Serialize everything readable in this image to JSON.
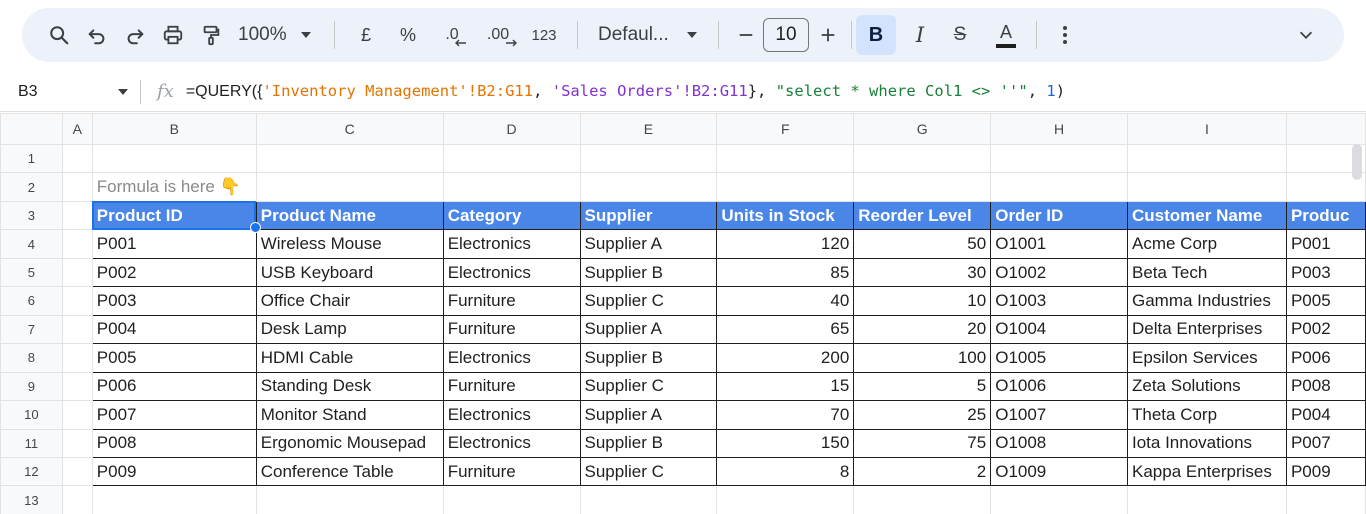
{
  "toolbar": {
    "zoom": "100%",
    "currency": "£",
    "percent": "%",
    "decrease_decimal": ".0",
    "increase_decimal": ".00",
    "number_format": "123",
    "font": "Defaul...",
    "font_size": "10",
    "bold": "B",
    "italic": "I",
    "strikethrough": "S",
    "text_color": "A"
  },
  "formula_bar": {
    "cell_ref": "B3",
    "fx": "fx",
    "parts": {
      "p1": "=QUERY({",
      "p2": "'Inventory Management'!B2:G11",
      "p3": ", ",
      "p4": "'Sales Orders'!B2:G11",
      "p5": "}, ",
      "p6": "\"select * where Col1 <> ''\"",
      "p7": ", ",
      "p8": "1",
      "p9": ")"
    }
  },
  "columns": [
    "A",
    "B",
    "C",
    "D",
    "E",
    "F",
    "G",
    "H",
    "I",
    ""
  ],
  "rows": [
    "1",
    "2",
    "3",
    "4",
    "5",
    "6",
    "7",
    "8",
    "9",
    "10",
    "11",
    "12",
    "13"
  ],
  "note": "Formula is here 👇",
  "headers": [
    "Product ID",
    "Product Name",
    "Category",
    "Supplier",
    "Units in Stock",
    "Reorder Level",
    "Order ID",
    "Customer Name",
    "Produc"
  ],
  "table": [
    [
      "P001",
      "Wireless Mouse",
      "Electronics",
      "Supplier A",
      "120",
      "50",
      "O1001",
      "Acme Corp",
      "P001"
    ],
    [
      "P002",
      "USB Keyboard",
      "Electronics",
      "Supplier B",
      "85",
      "30",
      "O1002",
      "Beta Tech",
      "P003"
    ],
    [
      "P003",
      "Office Chair",
      "Furniture",
      "Supplier C",
      "40",
      "10",
      "O1003",
      "Gamma Industries",
      "P005"
    ],
    [
      "P004",
      "Desk Lamp",
      "Furniture",
      "Supplier A",
      "65",
      "20",
      "O1004",
      "Delta Enterprises",
      "P002"
    ],
    [
      "P005",
      "HDMI Cable",
      "Electronics",
      "Supplier B",
      "200",
      "100",
      "O1005",
      "Epsilon Services",
      "P006"
    ],
    [
      "P006",
      "Standing Desk",
      "Furniture",
      "Supplier C",
      "15",
      "5",
      "O1006",
      "Zeta Solutions",
      "P008"
    ],
    [
      "P007",
      "Monitor Stand",
      "Electronics",
      "Supplier A",
      "70",
      "25",
      "O1007",
      "Theta Corp",
      "P004"
    ],
    [
      "P008",
      "Ergonomic Mousepad",
      "Electronics",
      "Supplier B",
      "150",
      "75",
      "O1008",
      "Iota Innovations",
      "P007"
    ],
    [
      "P009",
      "Conference Table",
      "Furniture",
      "Supplier C",
      "8",
      "2",
      "O1009",
      "Kappa Enterprises",
      "P009"
    ]
  ],
  "colors": {
    "header_fill": "#4a86e8",
    "selection": "#1a73e8",
    "toolbar_bg": "#edf2fa"
  }
}
